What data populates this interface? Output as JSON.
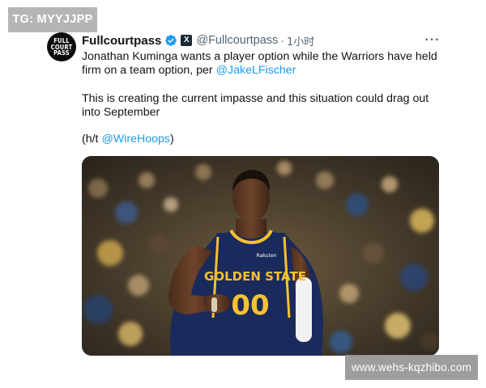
{
  "watermarks": {
    "top_left": "TG: MYYJJPP",
    "bottom_right": "www.wehs-kqzhibo.com"
  },
  "tweet": {
    "avatar": {
      "lines": [
        "FULL",
        "COURT",
        "PASS"
      ]
    },
    "author": {
      "name": "Fullcourtpass",
      "handle": "@Fullcourtpass",
      "separator": "·",
      "time": "1小时",
      "verified_icon": "verified-badge-icon",
      "affiliate_icon": "x-affiliate-icon"
    },
    "more_label": "···",
    "text": {
      "p1_before": "Jonathan Kuminga wants a player option while the Warriors have held firm on a team option, per ",
      "p1_mention": "@JakeLFischer",
      "p2": "This is creating the current impasse and this situation could drag out into September",
      "p3_before": "(h/t ",
      "p3_mention": "@WireHoops",
      "p3_after": ")"
    },
    "photo": {
      "jersey_text": "GOLDEN STATE",
      "jersey_number": "00",
      "jersey_brand": "Rakuten"
    }
  },
  "colors": {
    "link": "#1d9bf0",
    "verified": "#1d9bf0",
    "jersey_navy": "#1b2a5c",
    "jersey_gold": "#f5c12e"
  }
}
